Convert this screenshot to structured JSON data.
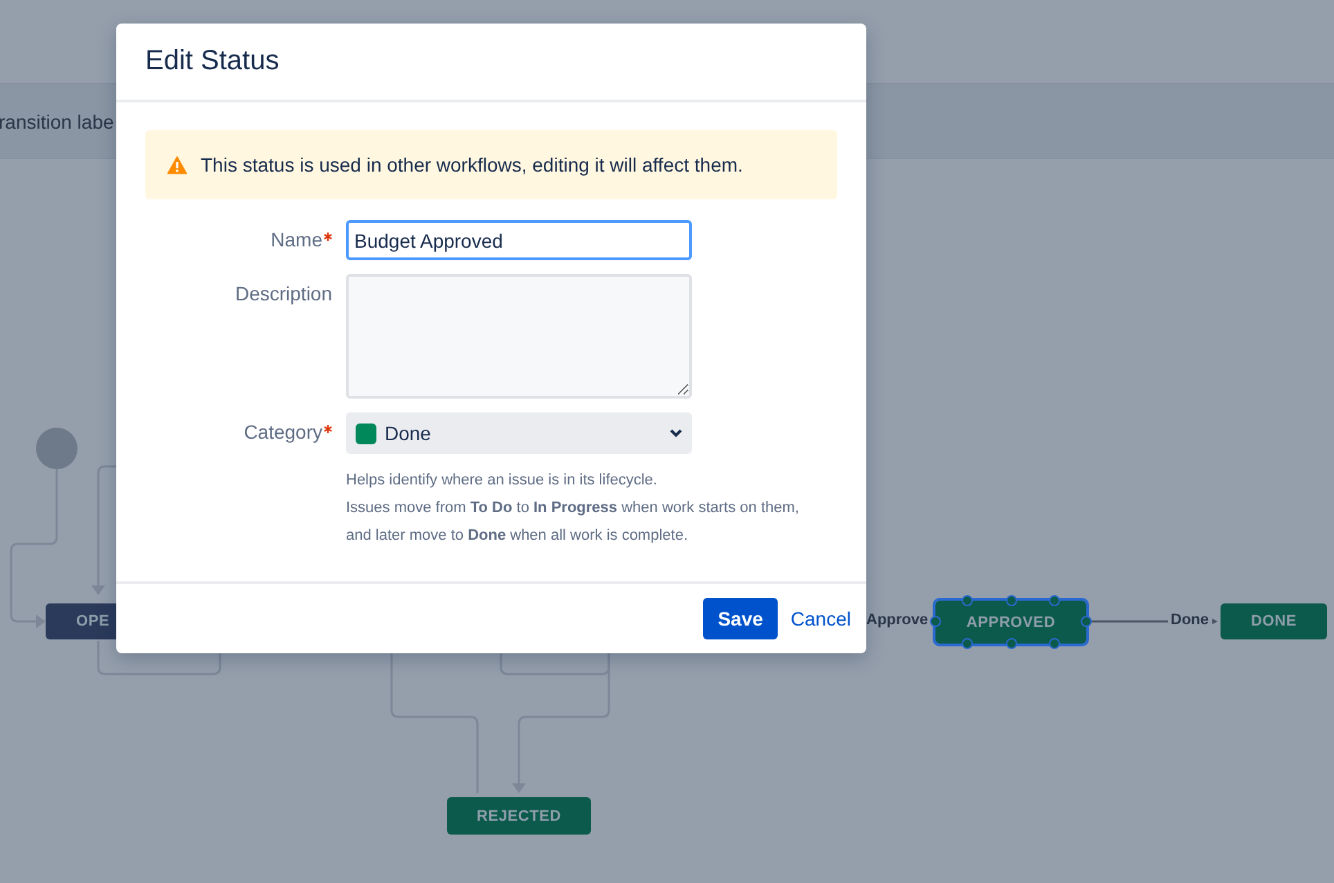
{
  "toolbar": {
    "text": "ransition labe"
  },
  "workflow": {
    "nodes": [
      {
        "label": "OPE",
        "kind": "todo",
        "selected": false
      },
      {
        "label": "APPROVED",
        "kind": "done",
        "selected": true
      },
      {
        "label": "DONE",
        "kind": "done",
        "selected": false
      },
      {
        "label": "REJECTED",
        "kind": "done",
        "selected": false
      }
    ],
    "transitions": [
      "Approve",
      "Done"
    ]
  },
  "dialog": {
    "title": "Edit Status",
    "warning": "This status is used in other workflows, editing it will affect them.",
    "name": {
      "label": "Name",
      "required": true,
      "value": "Budget Approved"
    },
    "description": {
      "label": "Description"
    },
    "category": {
      "label": "Category",
      "required": true,
      "value": "Done",
      "color": "#00875a"
    },
    "help": [
      "Helps identify where an issue is in its lifecycle.",
      "Issues move from **To Do** to **In Progress** when work starts on them,",
      "and later move to **Done** when all work is complete."
    ],
    "buttons": {
      "save": "Save",
      "cancel": "Cancel"
    }
  }
}
